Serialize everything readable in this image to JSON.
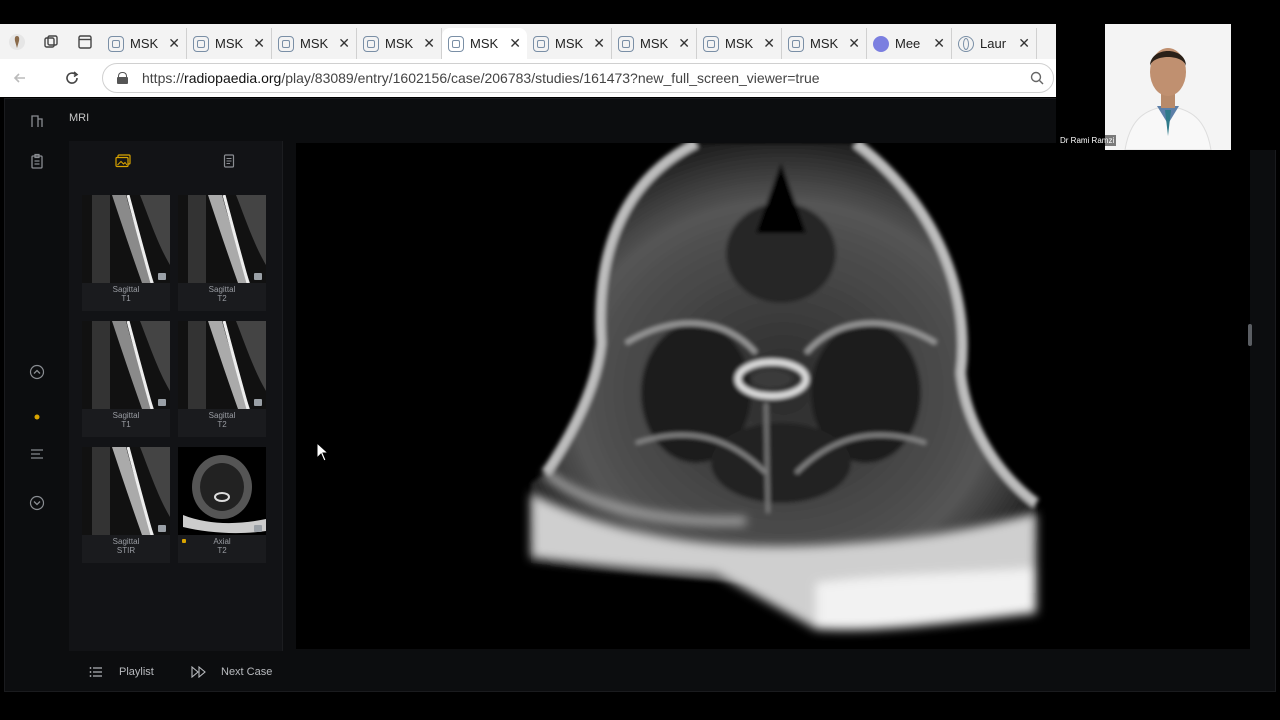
{
  "browser": {
    "tabs": [
      {
        "label": "MSK",
        "icon": "doc-icon"
      },
      {
        "label": "MSK",
        "icon": "doc-icon"
      },
      {
        "label": "MSK",
        "icon": "doc-icon"
      },
      {
        "label": "MSK",
        "icon": "doc-icon"
      },
      {
        "label": "MSK",
        "icon": "doc-icon",
        "active": true
      },
      {
        "label": "MSK",
        "icon": "doc-icon"
      },
      {
        "label": "MSK",
        "icon": "doc-icon"
      },
      {
        "label": "MSK",
        "icon": "doc-icon"
      },
      {
        "label": "MSK",
        "icon": "doc-icon"
      },
      {
        "label": "Mee",
        "icon": "zoom-icon"
      },
      {
        "label": "Laur",
        "icon": "globe-icon"
      }
    ],
    "close_glyph": "✕",
    "url_scheme": "https://",
    "url_host": "radiopaedia.org",
    "url_path": "/play/83089/entry/1602156/case/206783/studies/161473?new_full_screen_viewer=true"
  },
  "viewer": {
    "modality_title": "MRI",
    "series": [
      {
        "line1": "Sagittal",
        "line2": "T1"
      },
      {
        "line1": "Sagittal",
        "line2": "T2"
      },
      {
        "line1": "Sagittal",
        "line2": "T1"
      },
      {
        "line1": "Sagittal",
        "line2": "T2"
      },
      {
        "line1": "Sagittal",
        "line2": "STIR"
      },
      {
        "line1": "Axial",
        "line2": "T2",
        "selected": true
      }
    ],
    "playlist_label": "Playlist",
    "next_case_label": "Next Case",
    "accent_color": "#d9a400"
  },
  "webcam": {
    "participant_name": "Dr Rami Ramzi"
  }
}
